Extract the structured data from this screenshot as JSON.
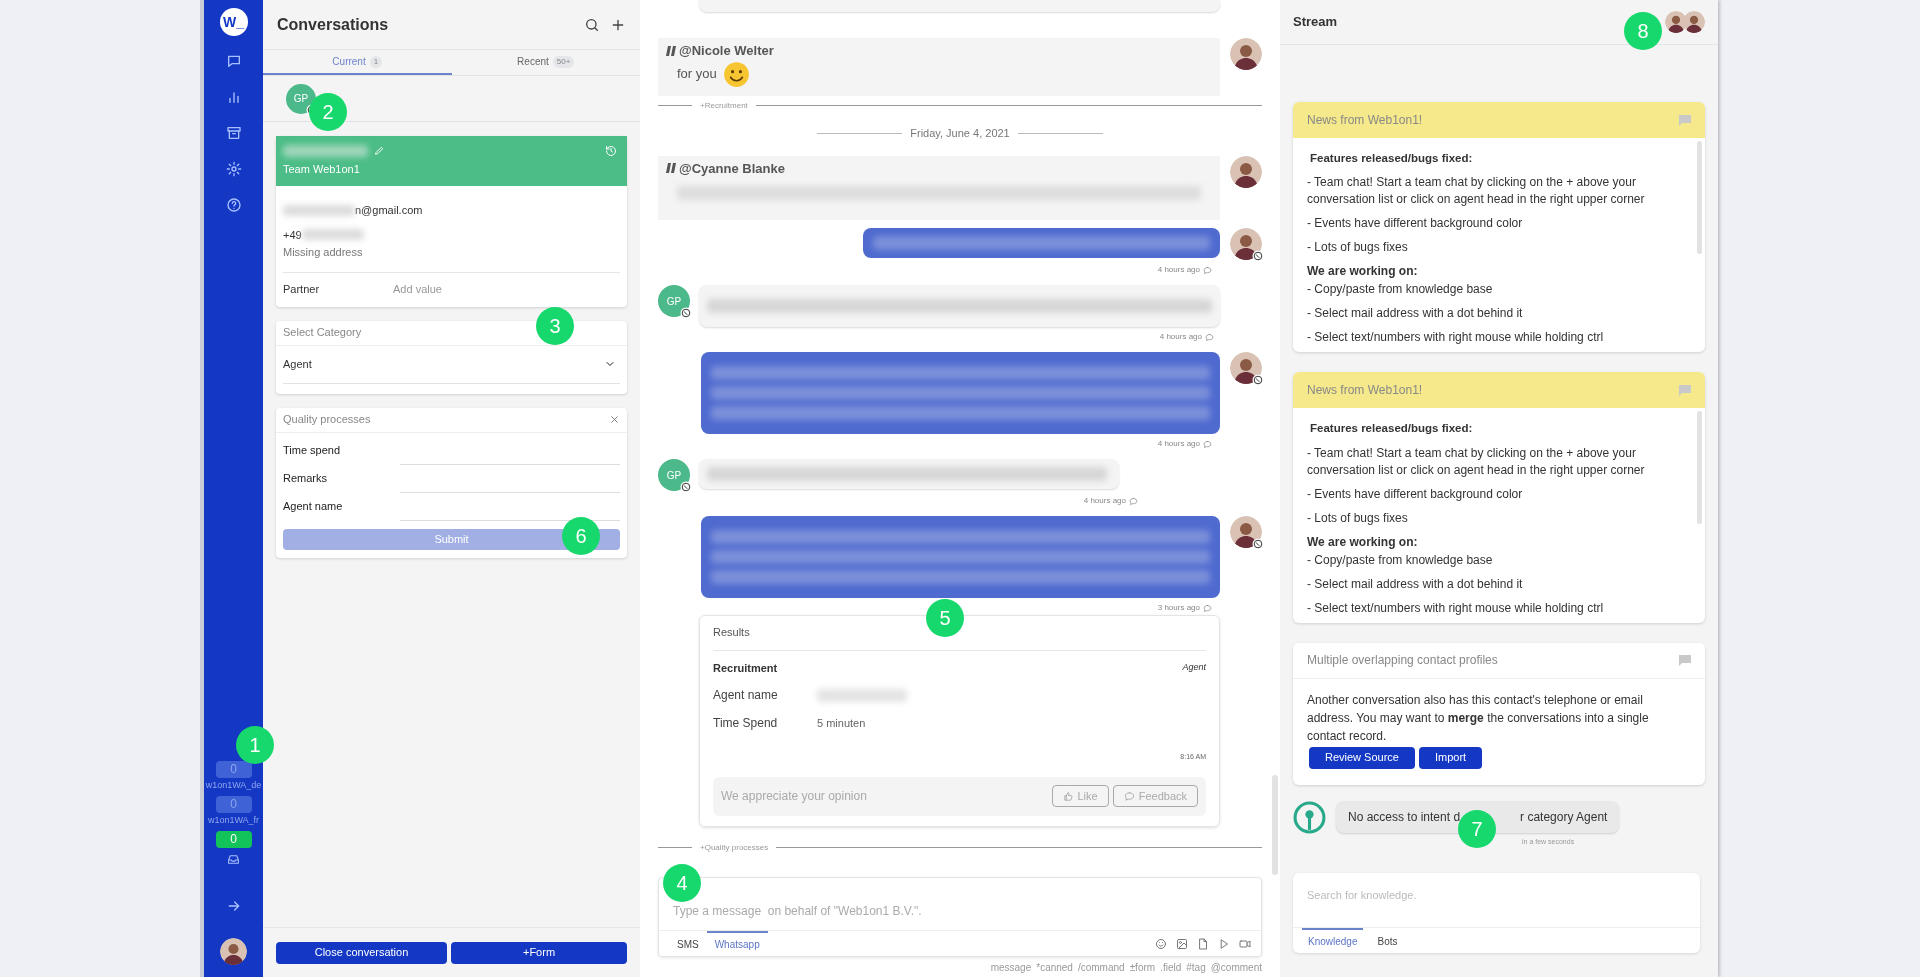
{
  "nav": {
    "logo": "W_",
    "channels": [
      {
        "count": "0",
        "label": "w1on1WA_de",
        "active": false
      },
      {
        "count": "0",
        "label": "w1on1WA_fr",
        "active": false
      },
      {
        "count": "0",
        "active": true
      }
    ]
  },
  "conversations": {
    "title": "Conversations",
    "tabs": [
      {
        "label": "Current",
        "count": "1",
        "selected": true
      },
      {
        "label": "Recent",
        "count": "50+",
        "selected": false
      }
    ],
    "contact_initials": "GP",
    "contact_card": {
      "team": "Team Web1on1",
      "email_end": "n@gmail.com",
      "phone_start": "+49",
      "address": "Missing address",
      "field_label": "Partner",
      "field_placeholder": "Add value"
    },
    "category": {
      "label": "Select Category",
      "value": "Agent"
    },
    "quality_form": {
      "title": "Quality processes",
      "fields": [
        {
          "label": "Time spend"
        },
        {
          "label": "Remarks"
        },
        {
          "label": "Agent name"
        }
      ],
      "submit": {
        "label": "Submit",
        "disabled": true
      }
    },
    "buttons": [
      "Close conversation",
      "+Form"
    ]
  },
  "chat": {
    "messages": [
      {
        "kind": "note",
        "author": "@Nicole Welter",
        "text": "for you"
      },
      {
        "kind": "event",
        "text": "+Recruitment"
      },
      {
        "kind": "date",
        "text": "Friday, June 4, 2021"
      },
      {
        "kind": "note",
        "author": "@Cyanne Blanke",
        "blurred": true
      },
      {
        "kind": "outgoing",
        "blurred": true,
        "multiline": false,
        "time": "4 hours ago"
      },
      {
        "kind": "incoming",
        "initials": "GP",
        "blurred": true,
        "wide": true,
        "time": "4 hours ago"
      },
      {
        "kind": "outgoing",
        "blurred": true,
        "multiline": true,
        "time": "4 hours ago"
      },
      {
        "kind": "incoming",
        "initials": "GP",
        "blurred": true,
        "wide": false,
        "time": "4 hours ago"
      },
      {
        "kind": "outgoing",
        "blurred": true,
        "multiline": true,
        "time": "3 hours ago"
      },
      {
        "kind": "results",
        "title": "Results",
        "category": "Recruitment",
        "tag": "Agent",
        "rows": [
          {
            "label": "Agent name",
            "blurred": true
          },
          {
            "label": "Time Spend",
            "value": "5 minuten"
          }
        ],
        "time": "8:16 AM",
        "prompt": "We appreciate your opinion",
        "buttons": [
          "Like",
          "Feedback"
        ]
      },
      {
        "kind": "event",
        "text": "+Quality processes"
      }
    ],
    "composer": {
      "placeholder": "Type a message  on behalf of \"Web1on1 B.V.\".",
      "tabs": [
        {
          "label": "SMS",
          "selected": false
        },
        {
          "label": "Whatsapp",
          "selected": true
        }
      ]
    },
    "hints": [
      "message",
      "*canned",
      "/command",
      "±form",
      ".field",
      "#tag",
      "@comment"
    ]
  },
  "stream": {
    "title": "Stream",
    "cards": [
      {
        "kind": "news",
        "title": "News from Web1on1!",
        "heading": "Features released/bugs fixed:",
        "items": [
          "- Team chat! Start a team chat by clicking on the + above your conversation list or click on agent head in the right upper corner",
          "- Events have different background color",
          "- Lots of bugs fixes"
        ],
        "heading2": "We are working on:",
        "items2": [
          "- Copy/paste from knowledge base",
          "- Select mail address with a dot behind it",
          "- Select text/numbers with right mouse while holding ctrl"
        ]
      },
      {
        "kind": "news",
        "title": "News from Web1on1!",
        "heading": "Features released/bugs fixed:",
        "items": [
          "- Team chat! Start a team chat by clicking on the + above your conversation list or click on agent head in the right upper corner",
          "- Events have different background color",
          "- Lots of bugs fixes"
        ],
        "heading2": "We are working on:",
        "items2": [
          "- Copy/paste from knowledge base",
          "- Select mail address with a dot behind it",
          "- Select text/numbers with right mouse while holding ctrl"
        ]
      },
      {
        "kind": "notice",
        "title": "Multiple overlapping contact profiles",
        "text": "Another conversation also has this contact's telephone or email address. You may want to **merge** the conversations into a single contact record.",
        "buttons": [
          "Review Source",
          "Import"
        ]
      }
    ],
    "bot_message": {
      "text_start": "No access to intent d",
      "text_end": "r category Agent",
      "time": "in a few seconds"
    },
    "knowledge": {
      "placeholder": "Search for knowledge.",
      "tabs": [
        {
          "label": "Knowledge",
          "selected": true
        },
        {
          "label": "Bots",
          "selected": false
        }
      ]
    }
  },
  "callouts": [
    "1",
    "2",
    "3",
    "4",
    "5",
    "6",
    "7",
    "8"
  ]
}
